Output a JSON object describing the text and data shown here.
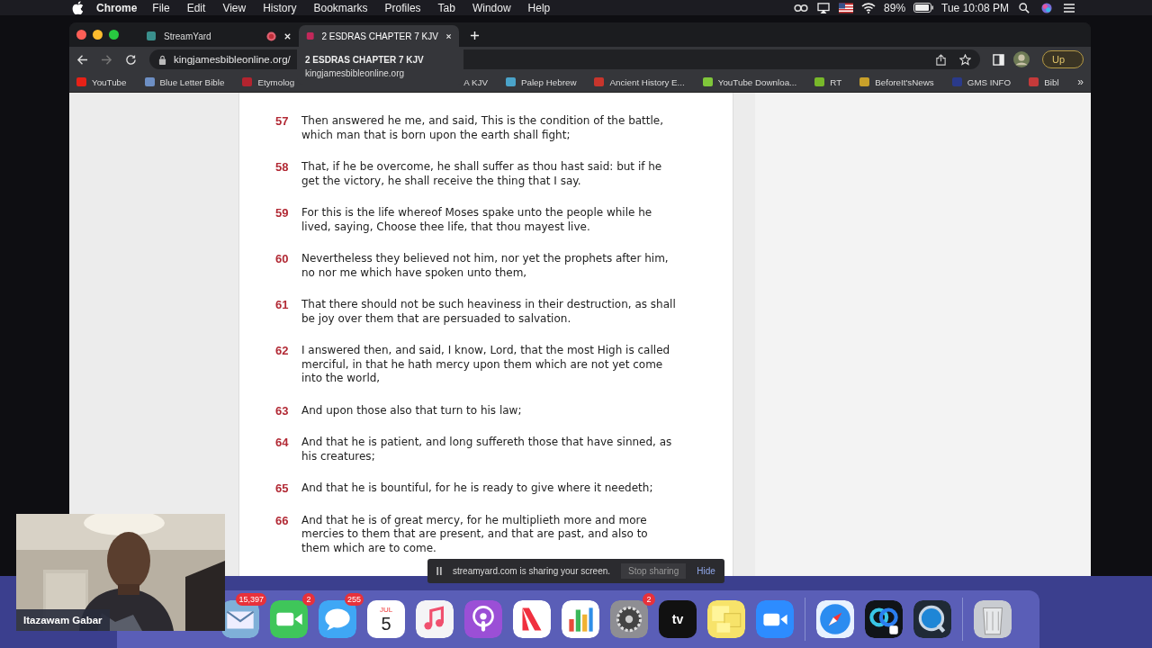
{
  "menu_bar": {
    "app": "Chrome",
    "menus": [
      "File",
      "Edit",
      "View",
      "History",
      "Bookmarks",
      "Profiles",
      "Tab",
      "Window",
      "Help"
    ],
    "battery": "89%",
    "clock": "Tue 10:08 PM"
  },
  "tabs": [
    {
      "title": "StreamYard",
      "selected": false,
      "recording": true
    },
    {
      "title": "2 ESDRAS CHAPTER 7 KJV",
      "selected": true,
      "recording": false
    }
  ],
  "address_bar": {
    "url": "kingjamesbibleonline.org/"
  },
  "update_button": "Up",
  "bookmarks": [
    {
      "label": "YouTube",
      "color": "#e62117"
    },
    {
      "label": "Blue Letter Bible",
      "color": "#6d8fc4"
    },
    {
      "label": "Etymolog",
      "color": "#b3242f"
    },
    {
      "label": "A KJV"
    },
    {
      "label": "Palep Hebrew",
      "color": "#4aa3c9"
    },
    {
      "label": "Ancient History E...",
      "color": "#c8352c"
    },
    {
      "label": "YouTube Downloa...",
      "color": "#7fc63a"
    },
    {
      "label": "RT",
      "color": "#78b82a"
    },
    {
      "label": "BeforeIt'sNews",
      "color": "#c8a02a"
    },
    {
      "label": "GMS INFO",
      "color": "#2a3a8a"
    },
    {
      "label": "Bibl",
      "color": "#c43a3a"
    }
  ],
  "bookmarks_more": "»",
  "tab_tooltip": {
    "title": "2 ESDRAS CHAPTER 7 KJV",
    "url": "kingjamesbibleonline.org"
  },
  "verses": [
    {
      "number": "57",
      "text": "Then answered he me, and said, This is the condition of the battle, which man that is born upon the earth shall fight;"
    },
    {
      "number": "58",
      "text": "That, if he be overcome, he shall suffer as thou hast said: but if he get the victory, he shall receive the thing that I say."
    },
    {
      "number": "59",
      "text": "For this is the life whereof Moses spake unto the people while he lived, saying, Choose thee life, that thou mayest live."
    },
    {
      "number": "60",
      "text": "Nevertheless they believed not him, nor yet the prophets after him, no nor me which have spoken unto them,"
    },
    {
      "number": "61",
      "text": "That there should not be such heaviness in their destruction, as shall be joy over them that are persuaded to salvation."
    },
    {
      "number": "62",
      "text": "I answered then, and said, I know, Lord, that the most High is called merciful, in that he hath mercy upon them which are not yet come into the world,"
    },
    {
      "number": "63",
      "text": "And upon those also that turn to his law;"
    },
    {
      "number": "64",
      "text": "And that he is patient, and long suffereth those that have sinned, as his creatures;"
    },
    {
      "number": "65",
      "text": "And that he is bountiful, for he is ready to give where it needeth;"
    },
    {
      "number": "66",
      "text": "And that he is of great mercy, for he multiplieth more and more mercies to them that are present, and that are past, and also to them which are to come."
    }
  ],
  "share_bar": {
    "message": "streamyard.com is sharing your screen.",
    "stop": "Stop sharing",
    "hide": "Hide"
  },
  "dock": [
    {
      "kind": "mail",
      "badge": "15,397"
    },
    {
      "kind": "facetime",
      "badge": "2"
    },
    {
      "kind": "messages",
      "badge": "255"
    },
    {
      "kind": "calendar",
      "month": "JUL",
      "day": "5"
    },
    {
      "kind": "music"
    },
    {
      "kind": "podcasts"
    },
    {
      "kind": "news"
    },
    {
      "kind": "numbers"
    },
    {
      "kind": "settings",
      "badge": "2"
    },
    {
      "kind": "tv",
      "label": "tv"
    },
    {
      "kind": "stickies"
    },
    {
      "kind": "zoom"
    },
    {
      "kind": "separator"
    },
    {
      "kind": "safari"
    },
    {
      "kind": "webex"
    },
    {
      "kind": "quicktime"
    },
    {
      "kind": "separator"
    },
    {
      "kind": "trash"
    }
  ],
  "webcam": {
    "kind": "picture",
    "name": "Itazawam Gabar"
  }
}
